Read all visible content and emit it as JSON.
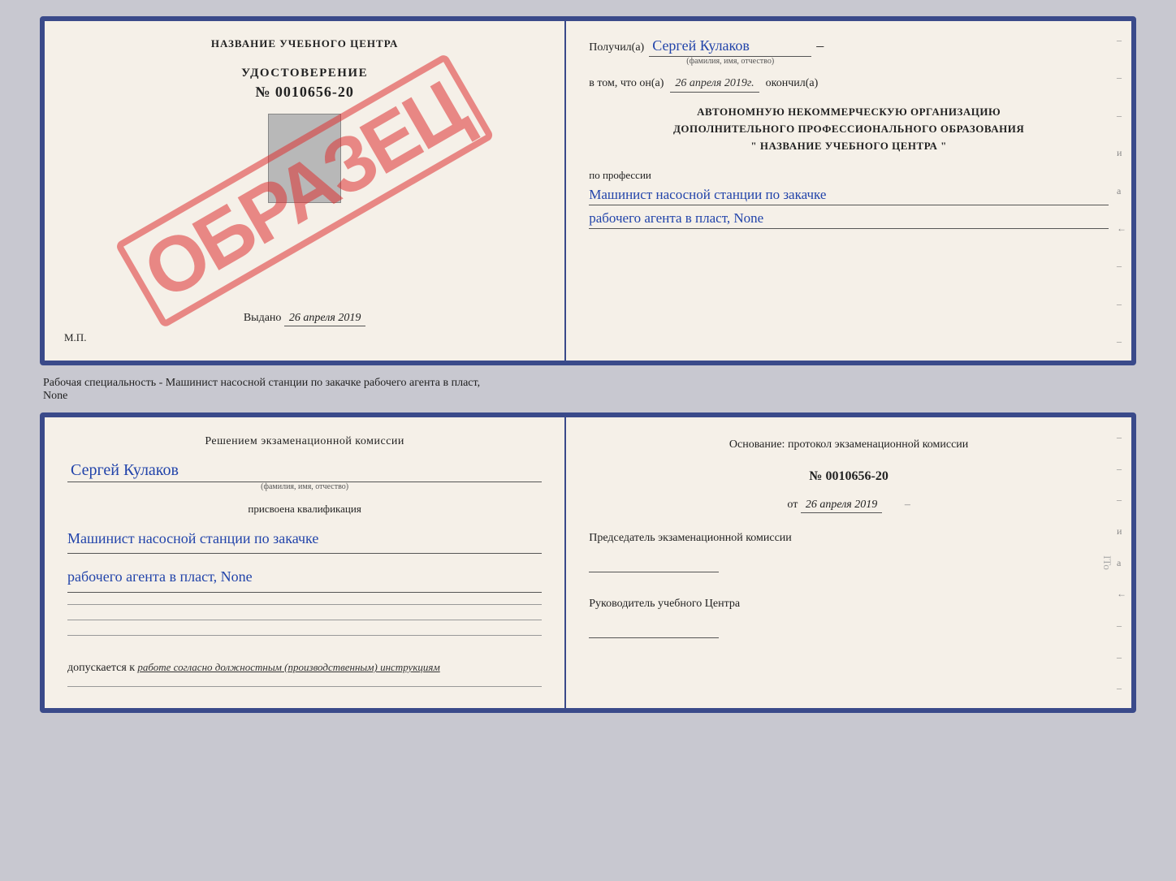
{
  "cert_top": {
    "left": {
      "title": "НАЗВАНИЕ УЧЕБНОГО ЦЕНТРА",
      "stamp": "ОБРАЗЕЦ",
      "udostoverenie_label": "УДОСТОВЕРЕНИЕ",
      "number": "№ 0010656-20",
      "vydano_label": "Выдано",
      "vydano_date": "26 апреля 2019",
      "mp": "М.П."
    },
    "right": {
      "poluchil_label": "Получил(a)",
      "poluchil_value": "Сергей Кулаков",
      "familiya_label": "(фамилия, имя, отчество)",
      "vtom_label": "в том, что он(а)",
      "vtom_date": "26 апреля 2019г.",
      "okonchil_label": "окончил(а)",
      "org_line1": "АВТОНОМНУЮ НЕКОММЕРЧЕСКУЮ ОРГАНИЗАЦИЮ",
      "org_line2": "ДОПОЛНИТЕЛЬНОГО ПРОФЕССИОНАЛЬНОГО ОБРАЗОВАНИЯ",
      "org_line3": "\"  НАЗВАНИЕ УЧЕБНОГО ЦЕНТРА  \"",
      "profession_label": "по профессии",
      "profession_line1": "Машинист насосной станции по закачке",
      "profession_line2": "рабочего агента в пласт, None"
    }
  },
  "subtitle": "Рабочая специальность - Машинист насосной станции по закачке рабочего агента в пласт,\nNone",
  "cert_bottom": {
    "left": {
      "komissia_label": "Решением экзаменационной комиссии",
      "name_value": "Сергей Кулаков",
      "familiya_label": "(фамилия, имя, отчество)",
      "prisvoena_label": "присвоена квалификация",
      "qualification_line1": "Машинист насосной станции по закачке",
      "qualification_line2": "рабочего агента в пласт, None",
      "dopusk_label": "допускается к",
      "dopusk_value": "работе согласно должностным (производственным) инструкциям"
    },
    "right": {
      "osnovaniye_label": "Основание: протокол экзаменационной комиссии",
      "protocol_number": "№ 0010656-20",
      "protocol_date_prefix": "от",
      "protocol_date": "26 апреля 2019",
      "predsedatel_label": "Председатель экзаменационной комиссии",
      "rukovoditel_label": "Руководитель учебного Центра"
    }
  }
}
